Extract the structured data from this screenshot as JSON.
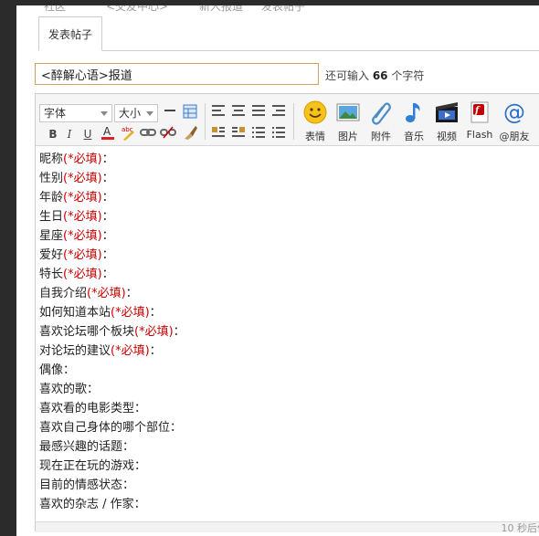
{
  "breadcrumb": {
    "items": [
      "社区",
      "<交友中心>",
      "新人报道",
      "发表帖子"
    ]
  },
  "tab": {
    "label": "发表帖子"
  },
  "subject": {
    "value": "<醉解心语>报道",
    "hint_prefix": "还可输入 ",
    "remaining": "66",
    "hint_suffix": " 个字符"
  },
  "toolbar": {
    "font_select": "字体",
    "size_select": "大小",
    "bold": "B",
    "italic": "I",
    "underline": "U",
    "big_buttons": [
      {
        "label": "表情",
        "icon": "smiley-icon"
      },
      {
        "label": "图片",
        "icon": "image-icon"
      },
      {
        "label": "附件",
        "icon": "paperclip-icon"
      },
      {
        "label": "音乐",
        "icon": "music-note-icon"
      },
      {
        "label": "视频",
        "icon": "video-icon"
      },
      {
        "label": "Flash",
        "icon": "flash-icon"
      },
      {
        "label": "@朋友",
        "icon": "at-icon"
      }
    ]
  },
  "content": {
    "required_mark": "(*必填)",
    "lines": [
      {
        "label": "昵称",
        "required": true
      },
      {
        "label": "性别",
        "required": true
      },
      {
        "label": "年龄",
        "required": true
      },
      {
        "label": "生日",
        "required": true
      },
      {
        "label": "星座",
        "required": true
      },
      {
        "label": "爱好",
        "required": true
      },
      {
        "label": "特长",
        "required": true
      },
      {
        "label": "自我介绍",
        "required": true
      },
      {
        "label": "如何知道本站",
        "required": true
      },
      {
        "label": "喜欢论坛哪个板块",
        "required": true
      },
      {
        "label": "对论坛的建议",
        "required": true
      },
      {
        "label": "偶像",
        "required": false
      },
      {
        "label": "喜欢的歌",
        "required": false
      },
      {
        "label": "喜欢看的电影类型",
        "required": false
      },
      {
        "label": "喜欢自己身体的哪个部位",
        "required": false
      },
      {
        "label": "最感兴趣的话题",
        "required": false
      },
      {
        "label": "现在正在玩的游戏",
        "required": false
      },
      {
        "label": "目前的情感状态",
        "required": false
      },
      {
        "label": "喜欢的杂志 / 作家",
        "required": false
      }
    ],
    "colon": "："
  },
  "status": {
    "autosave": "10 秒后保"
  },
  "colors": {
    "required": "#cc0000",
    "subject_border": "#d0a55a"
  }
}
